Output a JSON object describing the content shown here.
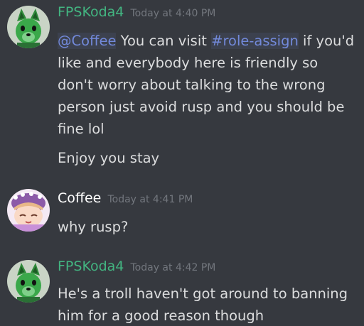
{
  "colors": {
    "background": "#36393f",
    "text": "#dcddde",
    "timestamp": "#72767d",
    "mention": "#7289da",
    "user_fpskoda4": "#43b581",
    "user_coffee": "#ffffff"
  },
  "messages": [
    {
      "username": "FPSKoda4",
      "username_color": "#43b581",
      "timestamp": "Today at 4:40 PM",
      "avatar_icon": "green-wolf-avatar",
      "mention": "@Coffee",
      "text_a": " You can visit ",
      "channel": "#role-assign",
      "text_b": " if you'd like and everybody here is friendly so don't worry about talking to the wrong person just avoid rusp and you should be fine lol",
      "text_c": "Enjoy you stay"
    },
    {
      "username": "Coffee",
      "username_color": "#ffffff",
      "timestamp": "Today at 4:41 PM",
      "avatar_icon": "anime-character-avatar",
      "text": "why rusp?"
    },
    {
      "username": "FPSKoda4",
      "username_color": "#43b581",
      "timestamp": "Today at 4:42 PM",
      "avatar_icon": "green-wolf-avatar",
      "text": "He's a troll haven't got around to banning him for a good reason though"
    }
  ]
}
